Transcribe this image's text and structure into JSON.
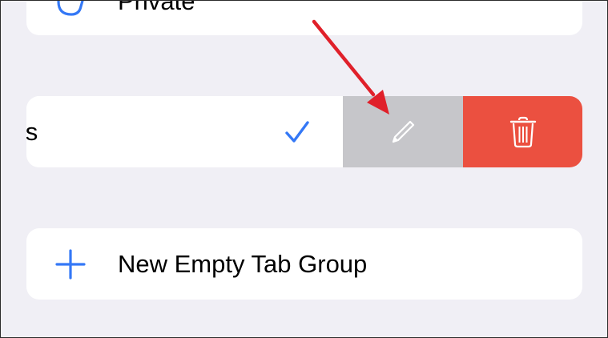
{
  "top_row": {
    "label": "Private",
    "icon": "hand-icon"
  },
  "swiped_row": {
    "label": "ces",
    "selected": true,
    "check_icon": "checkmark-icon",
    "check_color": "#3478f6",
    "actions": {
      "edit": {
        "icon": "pencil-icon",
        "color": "#c6c6ca"
      },
      "delete": {
        "icon": "trash-icon",
        "color": "#eb5040"
      }
    }
  },
  "new_group": {
    "label": "New Empty Tab Group",
    "icon": "plus-icon",
    "icon_color": "#3478f6"
  },
  "annotation": {
    "arrow_color": "#e0202a"
  }
}
